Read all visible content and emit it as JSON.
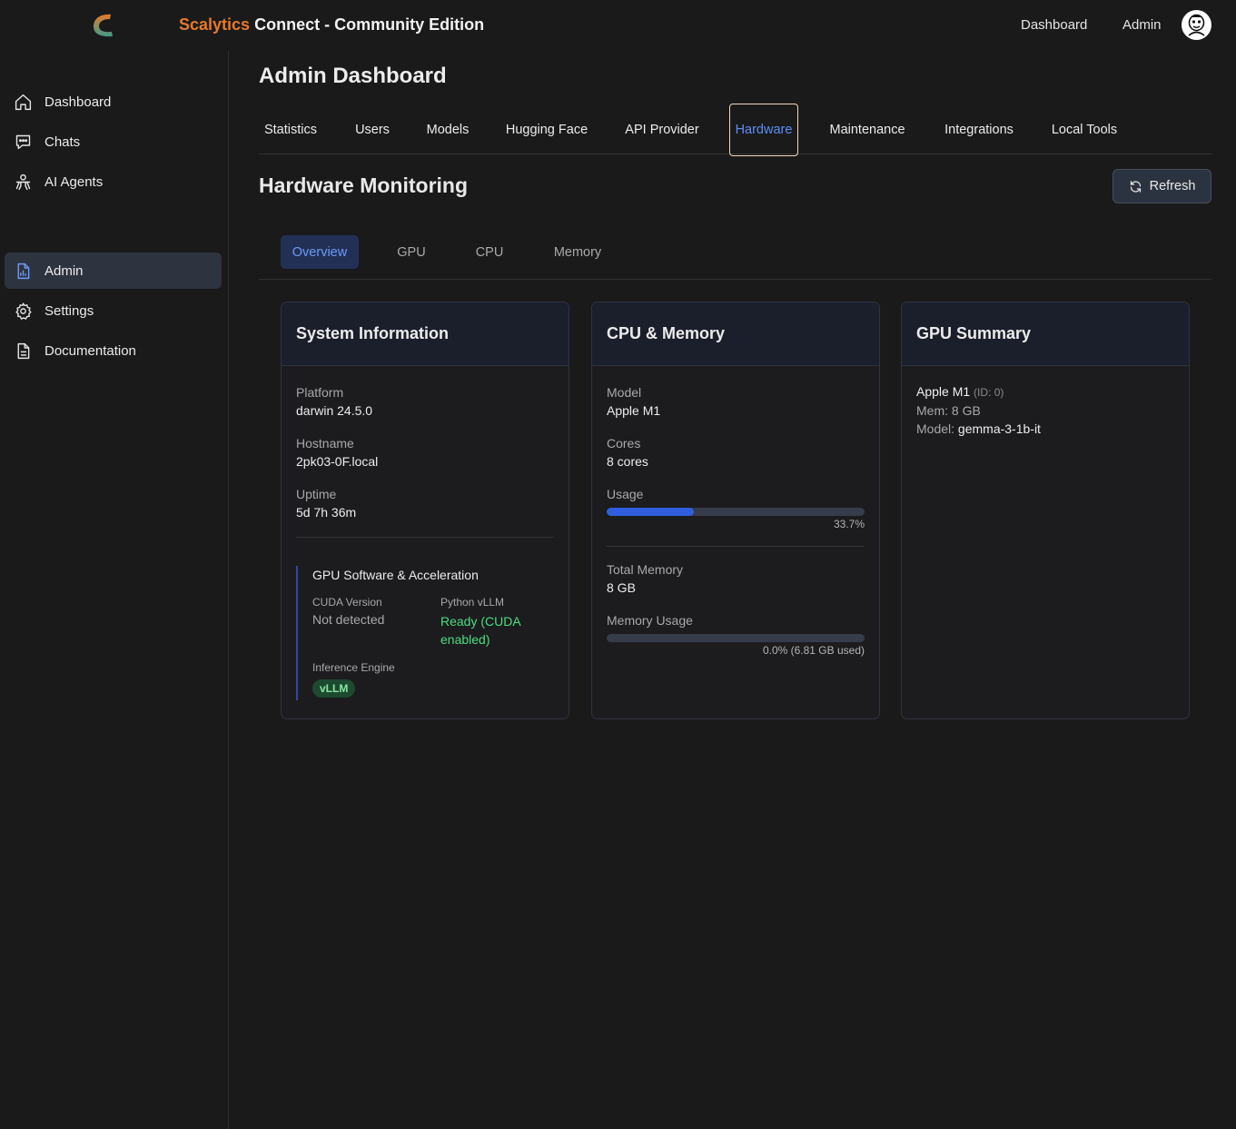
{
  "header": {
    "brand_accent": "Scalytics",
    "brand_rest": "Connect - Community Edition",
    "nav": {
      "dashboard": "Dashboard",
      "admin": "Admin"
    }
  },
  "sidebar": {
    "items": [
      {
        "label": "Dashboard",
        "icon": "home-icon"
      },
      {
        "label": "Chats",
        "icon": "chat-icon"
      },
      {
        "label": "AI Agents",
        "icon": "agents-icon"
      },
      {
        "label": "Admin",
        "icon": "admin-chart-icon",
        "active": true
      },
      {
        "label": "Settings",
        "icon": "gear-icon"
      },
      {
        "label": "Documentation",
        "icon": "document-icon"
      }
    ]
  },
  "page": {
    "title": "Admin Dashboard"
  },
  "tabs": [
    "Statistics",
    "Users",
    "Models",
    "Hugging Face",
    "API Provider",
    "Hardware",
    "Maintenance",
    "Integrations",
    "Local Tools"
  ],
  "active_tab": "Hardware",
  "hardware": {
    "title": "Hardware Monitoring",
    "refresh_label": "Refresh",
    "subtabs": [
      "Overview",
      "GPU",
      "CPU",
      "Memory"
    ],
    "active_subtab": "Overview"
  },
  "system_info": {
    "title": "System Information",
    "platform_label": "Platform",
    "platform": "darwin 24.5.0",
    "hostname_label": "Hostname",
    "hostname": "2pk03-0F.local",
    "uptime_label": "Uptime",
    "uptime": "5d 7h 36m",
    "gpu_software": {
      "title": "GPU Software & Acceleration",
      "cuda_label": "CUDA Version",
      "cuda": "Not detected",
      "vllm_label": "Python vLLM",
      "vllm_line1": "Ready (CUDA",
      "vllm_line2": "enabled)",
      "engine_label": "Inference Engine",
      "engine": "vLLM"
    }
  },
  "cpu_memory": {
    "title": "CPU & Memory",
    "model_label": "Model",
    "model": "Apple M1",
    "cores_label": "Cores",
    "cores": "8 cores",
    "usage_label": "Usage",
    "usage_pct": 33.7,
    "usage_text": "33.7%",
    "total_label": "Total Memory",
    "total": "8 GB",
    "mem_usage_label": "Memory Usage",
    "mem_usage_pct": 0.0,
    "mem_usage_text": "0.0% (6.81 GB used)"
  },
  "gpu_summary": {
    "title": "GPU Summary",
    "name": "Apple M1",
    "id_text": "(ID: 0)",
    "mem_label": "Mem:",
    "mem": "8 GB",
    "model_label": "Model:",
    "model": "gemma-3-1b-it"
  },
  "colors": {
    "accent": "#e8792b",
    "active_blue": "#5b8ef5",
    "progress": "#2f5fe0",
    "success": "#4ade80"
  }
}
